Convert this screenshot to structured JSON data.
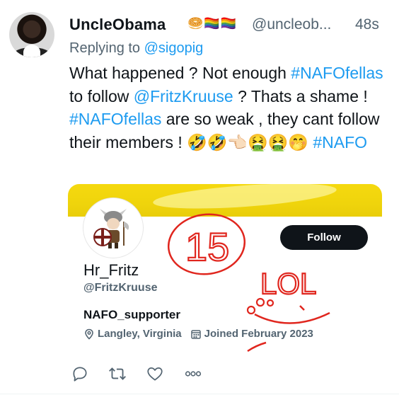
{
  "tweet": {
    "author_name": "UncleObama",
    "author_emojis": "🥯🏳️‍🌈🏳️‍🌈",
    "author_handle": "@uncleob...",
    "time": "48s",
    "replying_label": "Replying to",
    "replying_handle": "@sigopig",
    "text": [
      {
        "t": "What happened ?  Not enough ",
        "type": "text"
      },
      {
        "t": "#NAFOfellas",
        "type": "hashtag"
      },
      {
        "t": "  to follow ",
        "type": "text"
      },
      {
        "t": "@FritzKruuse",
        "type": "hashtag"
      },
      {
        "t": " ?  Thats a shame ! ",
        "type": "text"
      },
      {
        "t": "#NAFOfellas",
        "type": "hashtag"
      },
      {
        "t": "  are so weak , they cant follow their members ! ",
        "type": "text"
      },
      {
        "t": "🤣🤣👈🏻🤮🤮🤭 ",
        "type": "text"
      },
      {
        "t": "#NAFO",
        "type": "hashtag"
      }
    ]
  },
  "profile_card": {
    "follow_label": "Follow",
    "display_name": "Hr_Fritz",
    "handle": "@FritzKruuse",
    "bio": "NAFO_supporter",
    "location": "Langley, Virginia",
    "joined": "Joined February 2023"
  },
  "annotations": {
    "circled_number": "15",
    "scribble": "LOL"
  },
  "icons": {
    "reply": "reply-icon",
    "retweet": "retweet-icon",
    "like": "heart-icon",
    "more": "more-icon",
    "location": "location-pin-icon",
    "calendar": "calendar-icon"
  },
  "colors": {
    "link": "#1d9bf0",
    "secondary_text": "#536471",
    "banner": "#f2d60d",
    "annotation_red": "#e0261e",
    "follow_bg": "#0f1419"
  }
}
